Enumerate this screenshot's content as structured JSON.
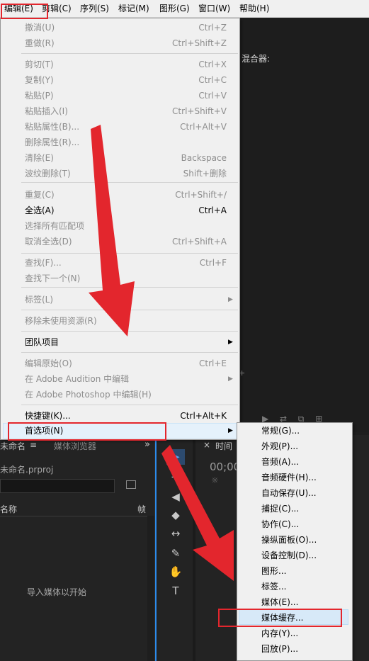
{
  "menubar": {
    "items": [
      "编辑(E)",
      "剪辑(C)",
      "序列(S)",
      "标记(M)",
      "图形(G)",
      "窗口(W)",
      "帮助(H)"
    ]
  },
  "background": {
    "mixer_label": "混合器:",
    "project_tab": "未命名",
    "media_browser_tab": "媒体浏览器",
    "panel_menu": "≡",
    "expand": "»",
    "project_file": "未命名.prproj",
    "name_column": "名称",
    "frame_column": "帧",
    "import_hint": "导入媒体以开始",
    "timeline_tab": "时间",
    "timecode": "00;00",
    "close_x": "×"
  },
  "edit_menu": {
    "items": [
      {
        "label": "撤消(U)",
        "shortcut": "Ctrl+Z",
        "enabled": false
      },
      {
        "label": "重做(R)",
        "shortcut": "Ctrl+Shift+Z",
        "enabled": false
      },
      {
        "label": "剪切(T)",
        "shortcut": "Ctrl+X",
        "enabled": false
      },
      {
        "label": "复制(Y)",
        "shortcut": "Ctrl+C",
        "enabled": false
      },
      {
        "label": "粘贴(P)",
        "shortcut": "Ctrl+V",
        "enabled": false
      },
      {
        "label": "粘贴插入(I)",
        "shortcut": "Ctrl+Shift+V",
        "enabled": false
      },
      {
        "label": "粘贴属性(B)...",
        "shortcut": "Ctrl+Alt+V",
        "enabled": false
      },
      {
        "label": "删除属性(R)...",
        "shortcut": "",
        "enabled": false
      },
      {
        "label": "清除(E)",
        "shortcut": "Backspace",
        "enabled": false
      },
      {
        "label": "波纹删除(T)",
        "shortcut": "Shift+删除",
        "enabled": false
      },
      {
        "label": "重复(C)",
        "shortcut": "Ctrl+Shift+/",
        "enabled": false
      },
      {
        "label": "全选(A)",
        "shortcut": "Ctrl+A",
        "enabled": true
      },
      {
        "label": "选择所有匹配项",
        "shortcut": "",
        "enabled": false
      },
      {
        "label": "取消全选(D)",
        "shortcut": "Ctrl+Shift+A",
        "enabled": false
      },
      {
        "label": "查找(F)...",
        "shortcut": "Ctrl+F",
        "enabled": false
      },
      {
        "label": "查找下一个(N)",
        "shortcut": "",
        "enabled": false
      },
      {
        "label": "标签(L)",
        "shortcut": "",
        "enabled": false,
        "submenu": true
      },
      {
        "label": "移除未使用资源(R)",
        "shortcut": "",
        "enabled": false
      },
      {
        "label": "团队项目",
        "shortcut": "",
        "enabled": true,
        "submenu": true
      },
      {
        "label": "编辑原始(O)",
        "shortcut": "Ctrl+E",
        "enabled": false
      },
      {
        "label": "在 Adobe Audition 中编辑",
        "shortcut": "",
        "enabled": false,
        "submenu": true
      },
      {
        "label": "在 Adobe Photoshop 中编辑(H)",
        "shortcut": "",
        "enabled": false
      },
      {
        "label": "快捷键(K)...",
        "shortcut": "Ctrl+Alt+K",
        "enabled": true
      },
      {
        "label": "首选项(N)",
        "shortcut": "",
        "enabled": true,
        "submenu": true,
        "highlighted": true
      }
    ]
  },
  "preferences_submenu": {
    "items": [
      "常规(G)...",
      "外观(P)...",
      "音频(A)...",
      "音频硬件(H)...",
      "自动保存(U)...",
      "捕捉(C)...",
      "协作(C)...",
      "操纵面板(O)...",
      "设备控制(D)...",
      "图形...",
      "标签...",
      "媒体(E)...",
      "媒体缓存...",
      "内存(Y)...",
      "回放(P)..."
    ],
    "highlighted_index": 12
  },
  "colors": {
    "annotation_red": "#e3262d",
    "menu_bg": "#f0f0f0",
    "highlight_blue": "#e5f1fb",
    "accent_blue": "#2d8ceb"
  }
}
